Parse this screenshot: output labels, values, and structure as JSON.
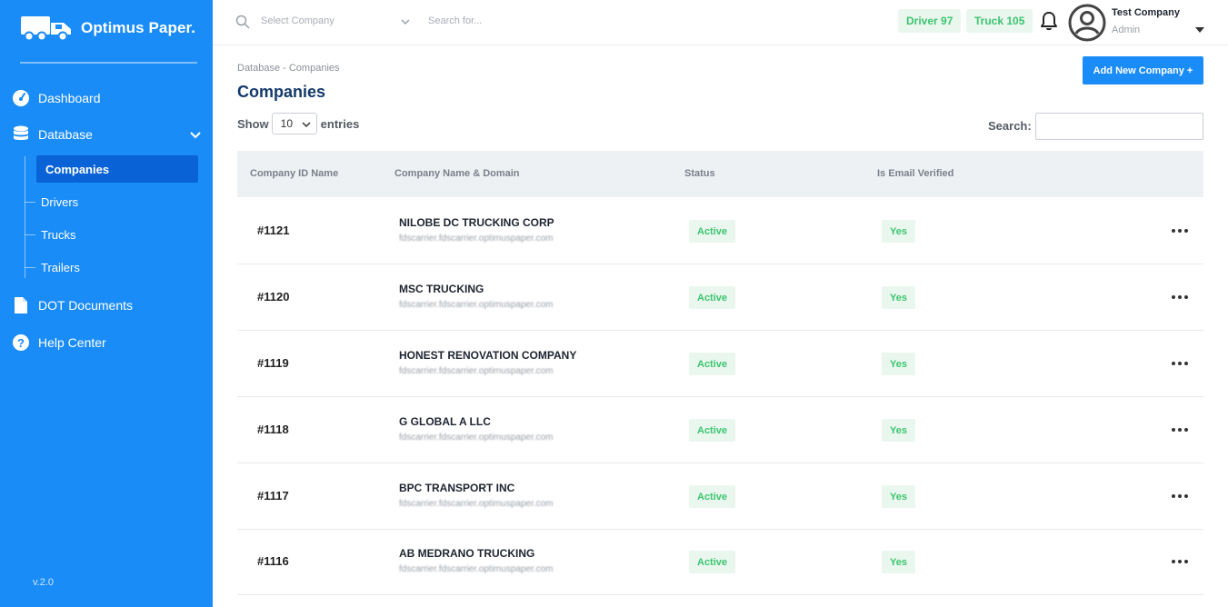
{
  "brand": {
    "name": "Optimus Paper."
  },
  "sidebar": {
    "items": [
      {
        "label": "Dashboard"
      },
      {
        "label": "Database"
      },
      {
        "label": "DOT Documents"
      },
      {
        "label": "Help Center"
      }
    ],
    "database_sub": [
      {
        "label": "Companies"
      },
      {
        "label": "Drivers"
      },
      {
        "label": "Trucks"
      },
      {
        "label": "Trailers"
      }
    ],
    "version": "v.2.0"
  },
  "topbar": {
    "company_select_placeholder": "Select Company",
    "search_placeholder": "Search for...",
    "driver_badge": "Driver 97",
    "truck_badge": "Truck 105",
    "user_name": "Test Company",
    "user_role": "Admin"
  },
  "content": {
    "breadcrumb": "Database - Companies",
    "title": "Companies",
    "add_button": "Add New Company +",
    "show_label": "Show",
    "entries_value": "10",
    "entries_label": "entries",
    "search_label": "Search:"
  },
  "table": {
    "headers": [
      "Company ID Name",
      "Company Name & Domain",
      "Status",
      "Is Email Verified"
    ],
    "rows": [
      {
        "id": "#1121",
        "name": "NILOBE DC TRUCKING CORP",
        "domain": "fdscarrier.fdscarrier.optimuspaper.com",
        "status": "Active",
        "verified": "Yes"
      },
      {
        "id": "#1120",
        "name": "MSC TRUCKING",
        "domain": "fdscarrier.fdscarrier.optimuspaper.com",
        "status": "Active",
        "verified": "Yes"
      },
      {
        "id": "#1119",
        "name": "HONEST RENOVATION COMPANY",
        "domain": "fdscarrier.fdscarrier.optimuspaper.com",
        "status": "Active",
        "verified": "Yes"
      },
      {
        "id": "#1118",
        "name": "G GLOBAL A LLC",
        "domain": "fdscarrier.fdscarrier.optimuspaper.com",
        "status": "Active",
        "verified": "Yes"
      },
      {
        "id": "#1117",
        "name": "BPC TRANSPORT INC",
        "domain": "fdscarrier.fdscarrier.optimuspaper.com",
        "status": "Active",
        "verified": "Yes"
      },
      {
        "id": "#1116",
        "name": "AB MEDRANO TRUCKING",
        "domain": "fdscarrier.fdscarrier.optimuspaper.com",
        "status": "Active",
        "verified": "Yes"
      }
    ]
  },
  "colors": {
    "accent": "#1a8cf7",
    "active_nav": "#0a63d6",
    "title": "#14396b",
    "success": "#3cc46f",
    "success_bg": "#e9f7ee"
  }
}
